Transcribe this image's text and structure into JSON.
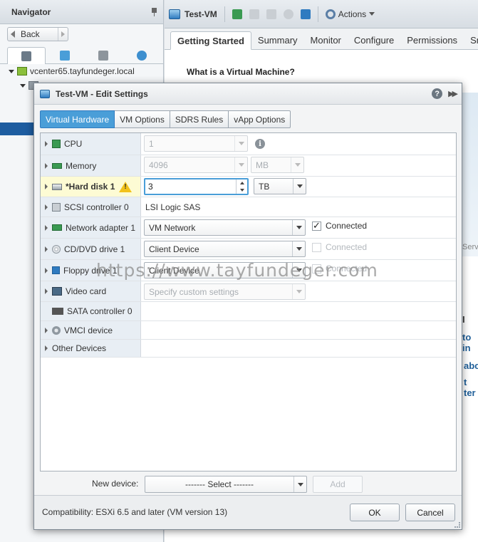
{
  "navigator": {
    "title": "Navigator",
    "back_label": "Back",
    "tree": {
      "vcenter_label": "vcenter65.tayfundeger.local"
    }
  },
  "main": {
    "vm_title": "Test-VM",
    "actions_label": "Actions",
    "tabs": [
      {
        "label": "Getting Started"
      },
      {
        "label": "Summary"
      },
      {
        "label": "Monitor"
      },
      {
        "label": "Configure"
      },
      {
        "label": "Permissions"
      },
      {
        "label": "Snaps"
      }
    ],
    "heading": "What is a Virtual Machine?",
    "partial_texts": [
      "Serv",
      "I",
      "to in",
      "abo",
      "t ter"
    ]
  },
  "dialog": {
    "title": "Test-VM - Edit Settings",
    "help_glyph": "?",
    "tabs": [
      {
        "label": "Virtual Hardware"
      },
      {
        "label": "VM Options"
      },
      {
        "label": "SDRS Rules"
      },
      {
        "label": "vApp Options"
      }
    ],
    "hardware": {
      "cpu": {
        "label": "CPU",
        "value": "1"
      },
      "memory": {
        "label": "Memory",
        "value": "4096",
        "unit": "MB"
      },
      "hard_disk": {
        "label": "*Hard disk 1",
        "value": "3",
        "unit": "TB"
      },
      "scsi": {
        "label": "SCSI controller 0",
        "value": "LSI Logic SAS"
      },
      "network": {
        "label": "Network adapter 1",
        "value": "VM Network",
        "connected_label": "Connected",
        "connected": true
      },
      "cddvd": {
        "label": "CD/DVD drive 1",
        "value": "Client Device",
        "connected_label": "Connected",
        "connected": false
      },
      "floppy": {
        "label": "Floppy drive 1",
        "value": "Client Device",
        "connected_label": "Connected",
        "connected": false
      },
      "video": {
        "label": "Video card",
        "value": "Specify custom settings"
      },
      "sata": {
        "label": "SATA controller 0"
      },
      "vmci": {
        "label": "VMCI device"
      },
      "other": {
        "label": "Other Devices"
      }
    },
    "watermark": "https://www.tayfundeger.com",
    "new_device": {
      "label": "New device:",
      "value": "------- Select -------",
      "add_label": "Add"
    },
    "compatibility": "Compatibility: ESXi 6.5 and later (VM version 13)",
    "ok_label": "OK",
    "cancel_label": "Cancel",
    "colors": {
      "accent": "#4a9ed8",
      "warning_row": "#fdfbd4",
      "label_column": "#e8eef4"
    }
  }
}
